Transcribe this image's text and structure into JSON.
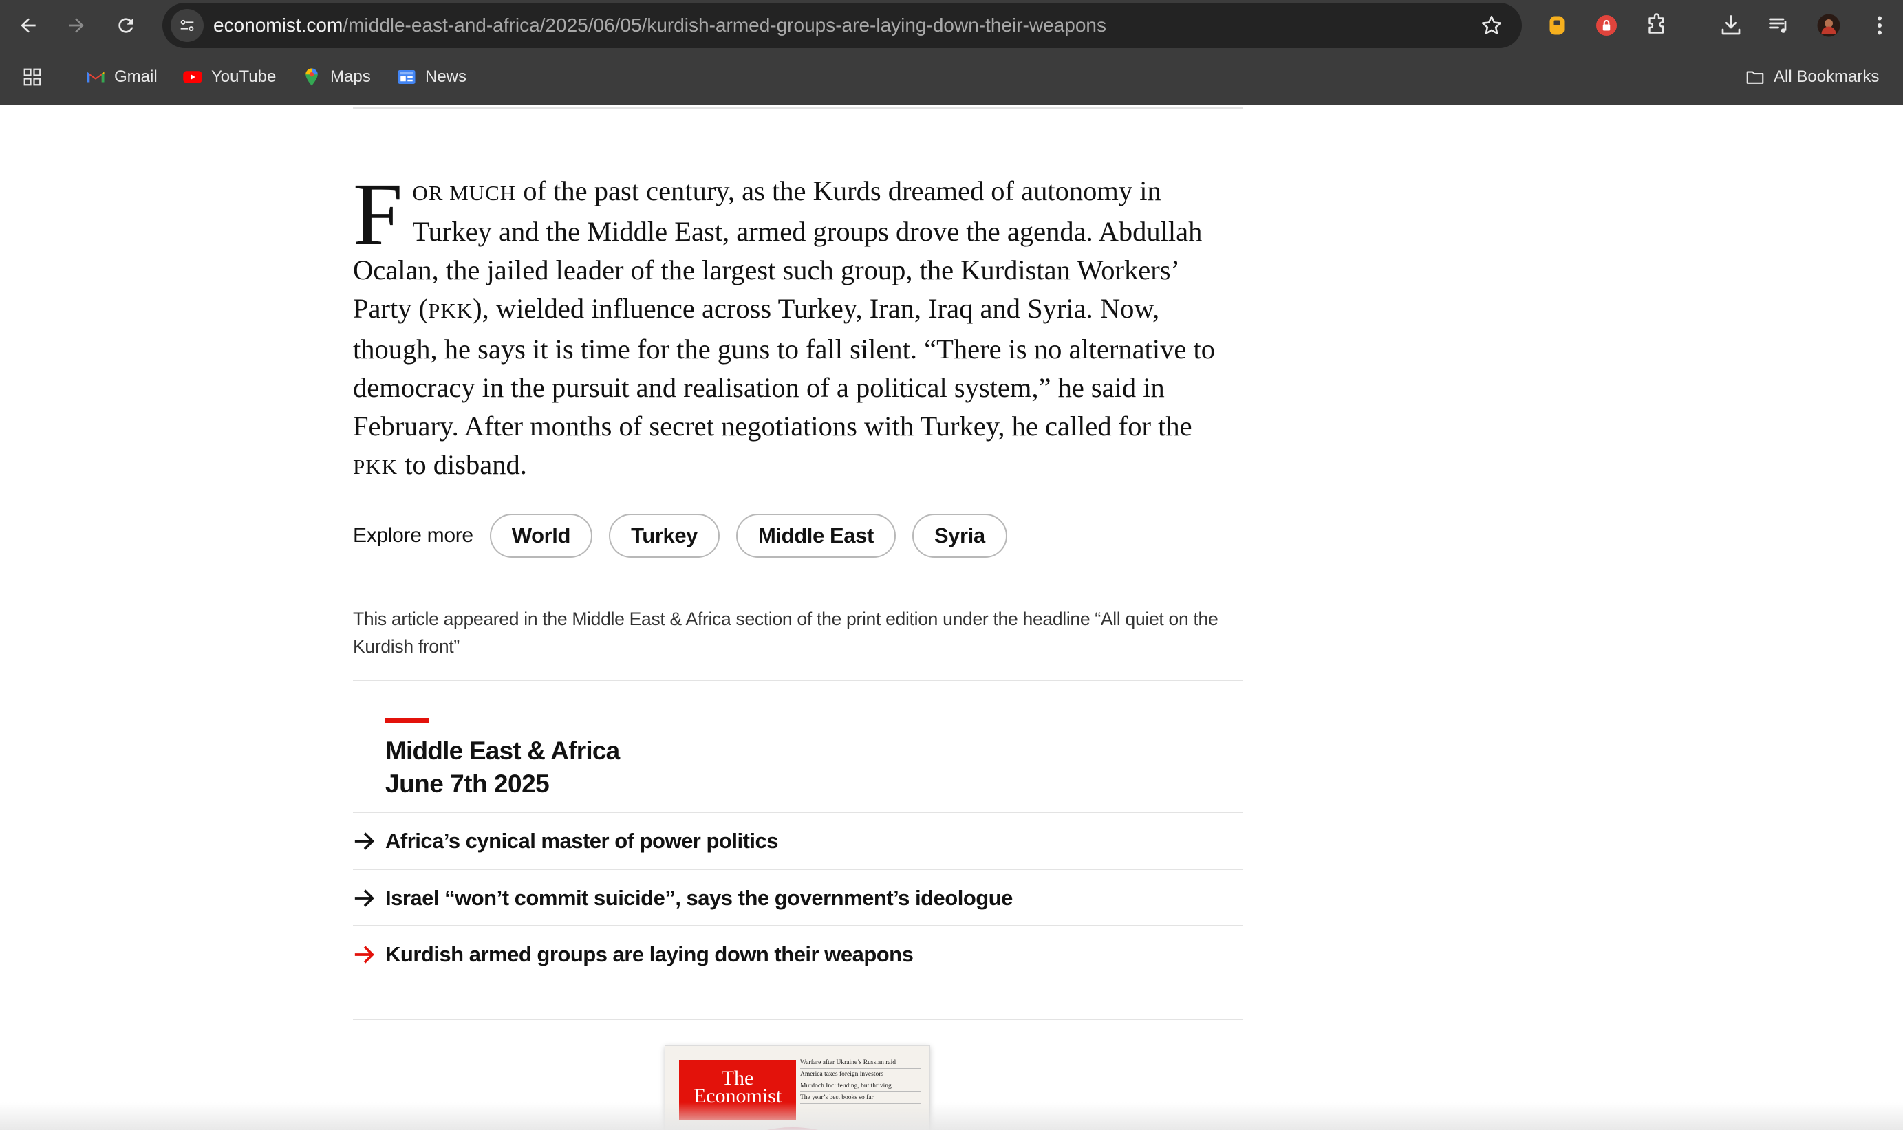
{
  "browser": {
    "url_host": "economist.com",
    "url_path": "/middle-east-and-africa/2025/06/05/kurdish-armed-groups-are-laying-down-their-weapons",
    "bookmarks": [
      {
        "label": "Gmail",
        "icon": "gmail-icon"
      },
      {
        "label": "YouTube",
        "icon": "youtube-icon"
      },
      {
        "label": "Maps",
        "icon": "maps-icon"
      },
      {
        "label": "News",
        "icon": "news-icon"
      }
    ],
    "all_bookmarks": "All Bookmarks",
    "colors": {
      "chrome": "#3c3c3c",
      "omnibox": "#232323"
    }
  },
  "article": {
    "dropcap": "F",
    "lead_smallcaps": "OR MUCH",
    "p1": " of the past century, as the Kurds dreamed of autonomy in Turkey and the Middle East, armed groups drove the agenda. Abdullah Ocalan, the jailed leader of the largest such group, the Kurdistan Workers’ Party (",
    "pkk1": "PKK",
    "p2": "), wielded influence across Turkey, Iran, Iraq and Syria. Now, though, he says it is time for the guns to fall silent. “There is no alternative to democracy in the pursuit and realisation of a political system,” he said in February. After months of secret negotiations with Turkey, he called for the ",
    "pkk2": "PKK",
    "p3": " to disband."
  },
  "explore": {
    "label": "Explore more",
    "tags": [
      "World",
      "Turkey",
      "Middle East",
      "Syria"
    ]
  },
  "print_note": "This article appeared in the Middle East & Africa section of the print edition under the headline “All quiet on the Kurdish front”",
  "section": {
    "title": "Middle East & Africa",
    "date": "June 7th 2025",
    "accent": "#e3120b",
    "links": [
      {
        "text": "Africa’s cynical master of power politics",
        "current": false
      },
      {
        "text": "Israel “won’t commit suicide”, says the government’s ideologue",
        "current": false
      },
      {
        "text": "Kurdish armed groups are laying down their weapons",
        "current": true
      }
    ]
  },
  "cover": {
    "logo_line1": "The",
    "logo_line2": "Economist",
    "headlines": [
      "Warfare after Ukraine’s Russian raid",
      "America taxes foreign investors",
      "Murdoch Inc: feuding, but thriving",
      "The year’s best books so far"
    ]
  }
}
